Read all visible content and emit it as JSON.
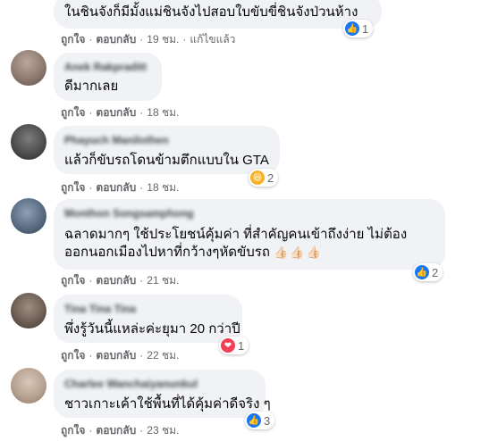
{
  "comments": [
    {
      "author": "",
      "text": "ในชินจังก็มีมั้งแม่ชินจังไปสอบใบขับขี่ชินจังป่วนห้าง",
      "like": "ถูกใจ",
      "reply": "ตอบกลับ",
      "time": "19 ชม.",
      "edited": "แก้ไขแล้ว",
      "reaction": "like",
      "reaction_count": "1"
    },
    {
      "author": "Anek Rakpraditt",
      "text": "ดีมากเลย",
      "like": "ถูกใจ",
      "reply": "ตอบกลับ",
      "time": "18 ชม."
    },
    {
      "author": "Phayuch Manilothen",
      "text": "แล้วก็ขับรถโดนข้ามตึกแบบใน GTA",
      "like": "ถูกใจ",
      "reply": "ตอบกลับ",
      "time": "18 ชม.",
      "reaction": "haha",
      "reaction_count": "2"
    },
    {
      "author": "Monthon Songsamphong",
      "text_line1": "ฉลาดมากๆ ใช้ประโยชน์คุ้มค่า ที่สำคัญคนเข้าถึงง่าย ไม่ต้อง",
      "text_line2": "ออกนอกเมืองไปหาที่กว้างๆหัดขับรถ",
      "emoji": "👍🏻👍🏻👍🏻",
      "like": "ถูกใจ",
      "reply": "ตอบกลับ",
      "time": "21 ชม.",
      "reaction": "like",
      "reaction_count": "2"
    },
    {
      "author": "Tina Tina Tina",
      "text": "พึ่งรู้วันนี้แหล่ะค่ะยุมา 20 กว่าปี",
      "like": "ถูกใจ",
      "reply": "ตอบกลับ",
      "time": "22 ชม.",
      "reaction": "love",
      "reaction_count": "1"
    },
    {
      "author": "Charlee Wanchaiyanunkul",
      "text": "ชาวเกาะเค้าใช้พื้นที่ได้คุ้มค่าดีจริง ๆ",
      "like": "ถูกใจ",
      "reply": "ตอบกลับ",
      "time": "23 ชม.",
      "reaction": "like",
      "reaction_count": "3"
    }
  ],
  "colors": {
    "bubble": "#f0f2f5",
    "meta": "#65676b",
    "like": "#1877f2",
    "love": "#f33e58",
    "haha": "#f7b125"
  }
}
